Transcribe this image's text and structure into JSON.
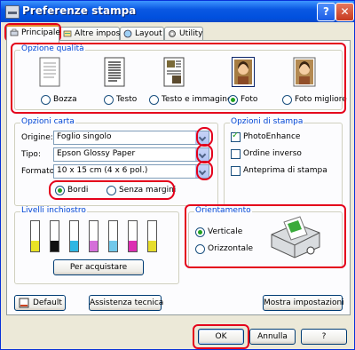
{
  "window": {
    "title": "Preferenze stampa",
    "help_label": "?",
    "close_label": "✕"
  },
  "tabs": [
    {
      "label": "Principale",
      "active": true
    },
    {
      "label": "Altre impost."
    },
    {
      "label": "Layout"
    },
    {
      "label": "Utility"
    }
  ],
  "quality": {
    "title": "Opzione qualità",
    "options": [
      {
        "label": "Bozza",
        "selected": false
      },
      {
        "label": "Testo",
        "selected": false
      },
      {
        "label": "Testo e immagine",
        "selected": false
      },
      {
        "label": "Foto",
        "selected": true
      },
      {
        "label": "Foto migliore",
        "selected": false
      }
    ]
  },
  "paper": {
    "title": "Opzioni carta",
    "origin_label": "Origine:",
    "origin_value": "Foglio singolo",
    "type_label": "Tipo:",
    "type_value": "Epson Glossy Paper",
    "format_label": "Formato:",
    "format_value": "10 x 15 cm (4 x 6 pol.)",
    "borders_label": "Bordi",
    "borderless_label": "Senza margini"
  },
  "print_options": {
    "title": "Opzioni di stampa",
    "photo_enhance": "PhotoEnhance",
    "reverse_order": "Ordine inverso",
    "preview": "Anteprima di stampa"
  },
  "ink": {
    "title": "Livelli inchiostro",
    "colors": [
      "#e9e225",
      "#111111",
      "#2fb6e3",
      "#d56fd9",
      "#72c8ea",
      "#dc2fb2",
      "#e6dd2b"
    ],
    "levels": [
      0.35,
      0.35,
      0.35,
      0.35,
      0.35,
      0.35,
      0.35
    ],
    "buy_button": "Per acquistare"
  },
  "orientation": {
    "title": "Orientamento",
    "portrait": "Verticale",
    "landscape": "Orizzontale"
  },
  "bottom": {
    "default_button": "Default",
    "support_button": "Assistenza tecnica",
    "show_settings_button": "Mostra impostazioni"
  },
  "footer": {
    "ok": "OK",
    "cancel": "Annulla",
    "help": "?"
  }
}
